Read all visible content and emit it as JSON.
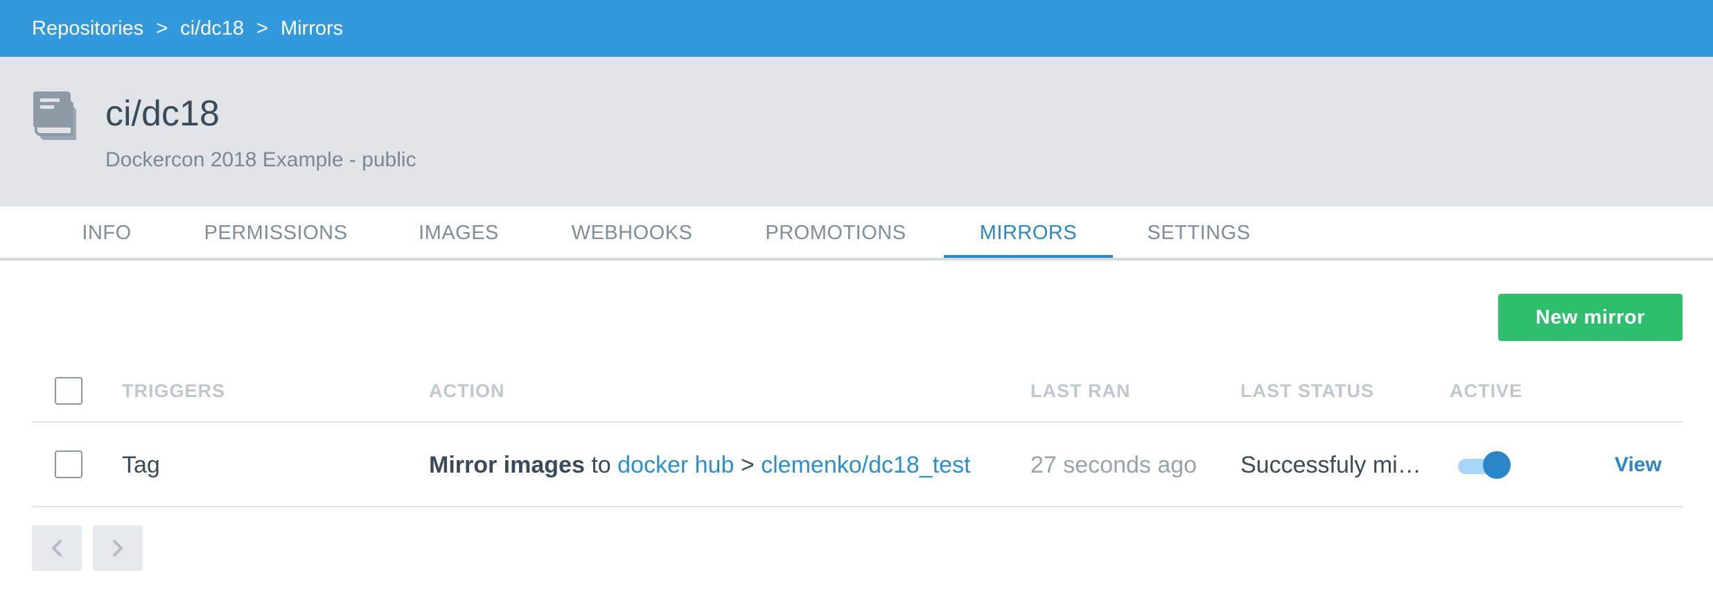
{
  "breadcrumb": {
    "items": [
      "Repositories",
      "ci/dc18",
      "Mirrors"
    ],
    "separator": ">"
  },
  "repo": {
    "name": "ci/dc18",
    "description": "Dockercon 2018 Example - public",
    "icon": "repository-stack-icon"
  },
  "tabs": [
    {
      "label": "INFO",
      "active": false
    },
    {
      "label": "PERMISSIONS",
      "active": false
    },
    {
      "label": "IMAGES",
      "active": false
    },
    {
      "label": "WEBHOOKS",
      "active": false
    },
    {
      "label": "PROMOTIONS",
      "active": false
    },
    {
      "label": "MIRRORS",
      "active": true
    },
    {
      "label": "SETTINGS",
      "active": false
    }
  ],
  "actions": {
    "new_mirror_label": "New mirror"
  },
  "table": {
    "columns": [
      "TRIGGERS",
      "ACTION",
      "LAST RAN",
      "LAST STATUS",
      "ACTIVE"
    ],
    "rows": [
      {
        "trigger": "Tag",
        "action_verb": "Mirror images",
        "action_to": "to",
        "action_target": "docker hub",
        "action_sep": ">",
        "action_repo": "clemenko/dc18_test",
        "last_ran": "27 seconds ago",
        "last_status": "Successfuly mirr...",
        "active": true,
        "view_label": "View"
      }
    ]
  },
  "colors": {
    "topbar": "#3399dd",
    "header_bg": "#e1e5e9",
    "accent": "#2a86c6",
    "link": "#2a8ed3",
    "primary_button": "#2dbf6c"
  }
}
